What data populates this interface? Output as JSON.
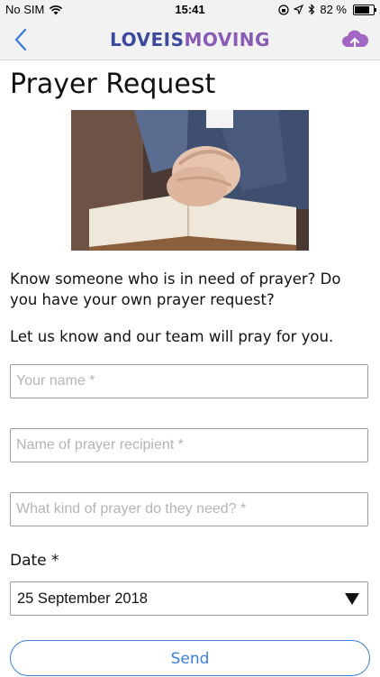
{
  "status_bar": {
    "carrier": "No SIM",
    "time": "15:41",
    "battery_percent": "82 %",
    "battery_level": 0.82,
    "icons": [
      "wifi-icon",
      "lock-rotation-icon",
      "location-icon",
      "bluetooth-icon",
      "battery-icon"
    ]
  },
  "nav": {
    "back_icon": "chevron-left-icon",
    "logo_part1": "LOVEIS",
    "logo_part2": "MOVING",
    "upload_icon": "cloud-upload-icon"
  },
  "colors": {
    "accent": "#3d7fd6",
    "logo_primary": "#3b4a9b",
    "logo_secondary": "#8a5bb5",
    "upload_icon": "#a267c4"
  },
  "page": {
    "title": "Prayer Request",
    "intro": "Know someone who is in need of prayer?  Do you have your own prayer request?",
    "intro2": "Let us know and our team will pray for you."
  },
  "form": {
    "name_placeholder": "Your name *",
    "name_value": "",
    "recipient_placeholder": "Name of prayer recipient *",
    "recipient_value": "",
    "need_placeholder": "What kind of prayer do they need? *",
    "need_value": "",
    "date_label": "Date *",
    "date_value": "25 September 2018",
    "send_label": "Send"
  }
}
